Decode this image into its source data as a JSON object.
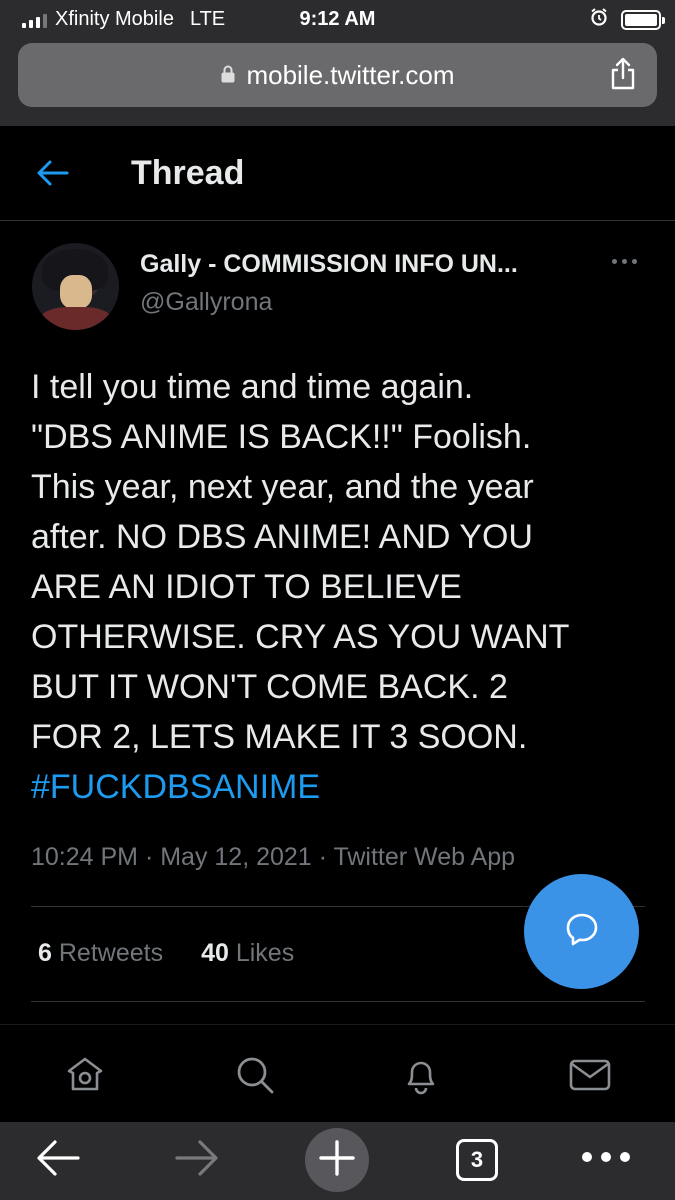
{
  "status_bar": {
    "carrier": "Xfinity Mobile",
    "network": "LTE",
    "time": "9:12 AM"
  },
  "url_bar": {
    "domain": "mobile.twitter.com"
  },
  "header": {
    "title": "Thread"
  },
  "tweet": {
    "display_name": "Gally - COMMISSION INFO UN...",
    "handle": "@Gallyrona",
    "text_lines": [
      "I tell you time and time again.",
      "\"DBS ANIME IS BACK!!\" Foolish.",
      "This year, next year, and the year",
      "after. NO DBS ANIME! AND YOU",
      "ARE AN IDIOT TO BELIEVE",
      "OTHERWISE. CRY AS YOU WANT",
      "BUT IT WON'T COME BACK. 2",
      "FOR 2, LETS MAKE IT 3 SOON."
    ],
    "hashtag": "#FUCKDBSANIME",
    "meta": "10:24 PM · May 12, 2021 · Twitter Web App",
    "retweets_count": "6",
    "retweets_label": "Retweets",
    "likes_count": "40",
    "likes_label": "Likes"
  },
  "tab_bar": {
    "icons": [
      "home-icon",
      "search-icon",
      "notifications-icon",
      "messages-icon"
    ]
  },
  "browser_toolbar": {
    "tabs_count": "3"
  },
  "colors": {
    "accent": "#1d9bf0",
    "fab": "#3b93e8",
    "muted": "#71767b",
    "text": "#e7e9ea"
  }
}
